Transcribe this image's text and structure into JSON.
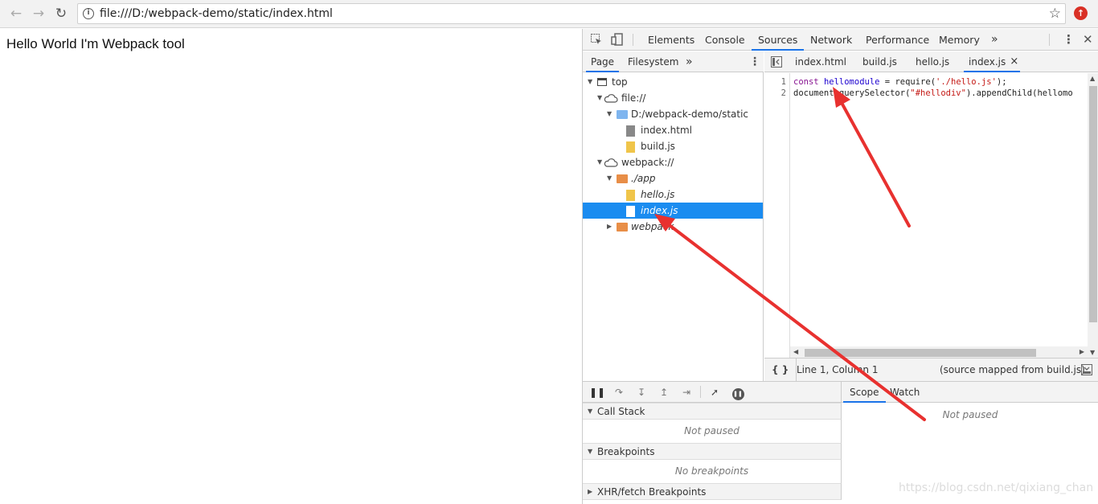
{
  "browser": {
    "url": "file:///D:/webpack-demo/static/index.html",
    "back_icon": "arrow-left",
    "forward_icon": "arrow-right",
    "reload_icon": "reload",
    "star_icon": "star"
  },
  "page": {
    "text": "Hello World I'm Webpack tool"
  },
  "devtools": {
    "tabs": [
      "Elements",
      "Console",
      "Sources",
      "Network",
      "Performance",
      "Memory"
    ],
    "active_tab": "Sources",
    "more": "»",
    "accent": "#1a73e8"
  },
  "navigator": {
    "tabs": [
      "Page",
      "Filesystem"
    ],
    "more": "»",
    "tree": [
      {
        "label": "top"
      },
      {
        "label": "file://"
      },
      {
        "label": "D:/webpack-demo/static"
      },
      {
        "label": "index.html"
      },
      {
        "label": "build.js"
      },
      {
        "label": "webpack://"
      },
      {
        "label": "./app"
      },
      {
        "label": "hello.js"
      },
      {
        "label": "index.js"
      },
      {
        "label": "webpack"
      }
    ],
    "selected_color": "#1a8cf0"
  },
  "editor": {
    "tabs": [
      "index.html",
      "build.js",
      "hello.js",
      "index.js"
    ],
    "close": "×",
    "line_numbers": [
      "1",
      "2"
    ],
    "line1": {
      "kw": "const",
      "var": "hellomodule",
      "mid": " = require(",
      "str": "'./hello.js'",
      "end": ");"
    },
    "line2": {
      "a": "document.querySelector(",
      "str": "\"#hellodiv\"",
      "b": ").appendChild(hellomo"
    },
    "status_left": "Line 1, Column 1",
    "status_right": "(source mapped from build.js)",
    "format_icon": "{ }"
  },
  "debugger": {
    "call_stack": "Call Stack",
    "not_paused": "Not paused",
    "breakpoints": "Breakpoints",
    "no_breakpoints": "No breakpoints",
    "xhr": "XHR/fetch Breakpoints",
    "scope_tabs": [
      "Scope",
      "Watch"
    ],
    "scope_body": "Not paused"
  },
  "watermark": "https://blog.csdn.net/qixiang_chan",
  "annotation_color": "#e8312f"
}
